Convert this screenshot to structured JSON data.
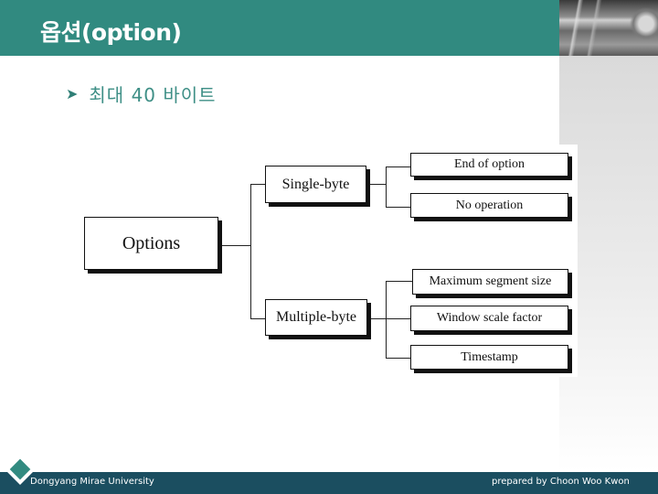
{
  "slide": {
    "title": "옵션(option)",
    "bullet_icon": "arrow-bullet-icon",
    "bullet_text": "최대 40 바이트"
  },
  "diagram": {
    "root": "Options",
    "categories": [
      {
        "label": "Single-byte",
        "children": [
          "End of option",
          "No operation"
        ]
      },
      {
        "label": "Multiple-byte",
        "children": [
          "Maximum segment size",
          "Window scale factor",
          "Timestamp"
        ]
      }
    ]
  },
  "footer": {
    "left_text": "Dongyang Mirae University",
    "right_text": "prepared by Choon Woo Kwon",
    "logo_icon": "diamond-logo-icon"
  },
  "colors": {
    "header": "#318a80",
    "footer": "#1b4e60",
    "bullet_text": "#3e8f86"
  }
}
